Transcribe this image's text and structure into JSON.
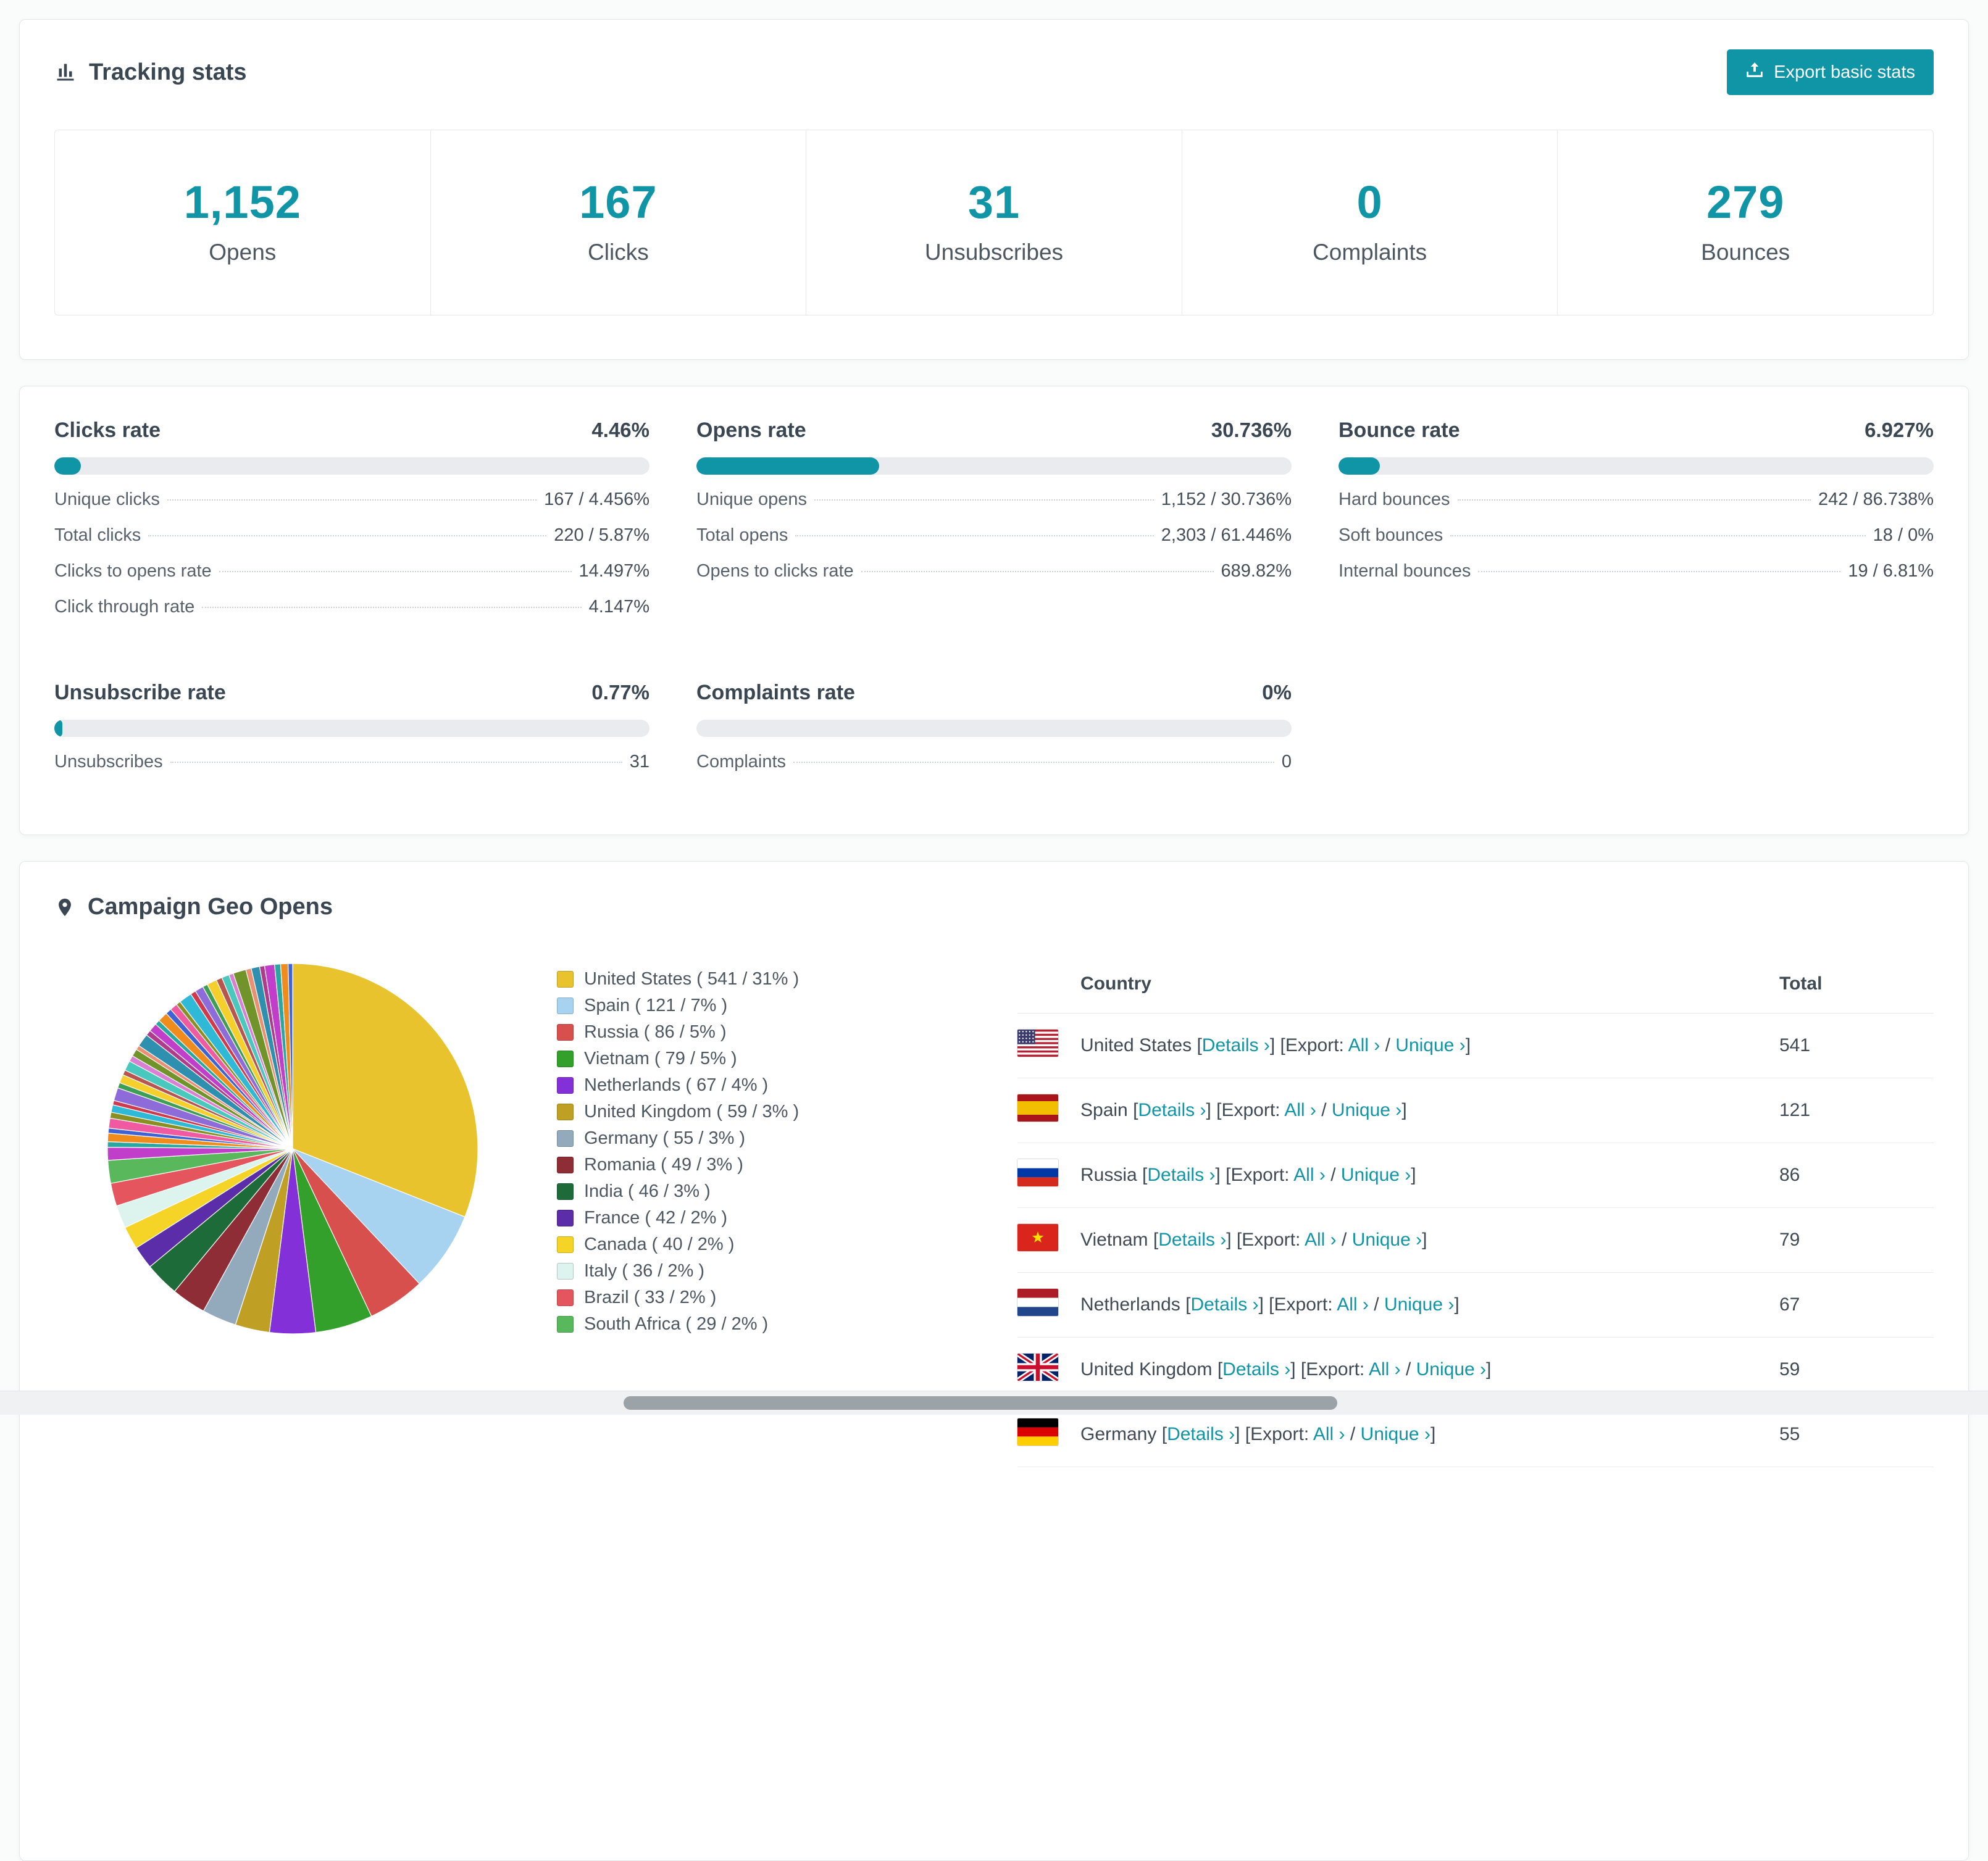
{
  "accent_color": "#1095a6",
  "tracking": {
    "title": "Tracking stats",
    "export_label": "Export basic stats",
    "stats": [
      {
        "value": "1,152",
        "label": "Opens"
      },
      {
        "value": "167",
        "label": "Clicks"
      },
      {
        "value": "31",
        "label": "Unsubscribes"
      },
      {
        "value": "0",
        "label": "Complaints"
      },
      {
        "value": "279",
        "label": "Bounces"
      }
    ]
  },
  "rates": [
    {
      "title": "Clicks rate",
      "percent_label": "4.46%",
      "percent": 4.46,
      "rows": [
        {
          "label": "Unique clicks",
          "value": "167 / 4.456%"
        },
        {
          "label": "Total clicks",
          "value": "220 / 5.87%"
        },
        {
          "label": "Clicks to opens rate",
          "value": "14.497%"
        },
        {
          "label": "Click through rate",
          "value": "4.147%"
        }
      ]
    },
    {
      "title": "Opens rate",
      "percent_label": "30.736%",
      "percent": 30.736,
      "rows": [
        {
          "label": "Unique opens",
          "value": "1,152 / 30.736%"
        },
        {
          "label": "Total opens",
          "value": "2,303 / 61.446%"
        },
        {
          "label": "Opens to clicks rate",
          "value": "689.82%"
        }
      ]
    },
    {
      "title": "Bounce rate",
      "percent_label": "6.927%",
      "percent": 6.927,
      "rows": [
        {
          "label": "Hard bounces",
          "value": "242 / 86.738%"
        },
        {
          "label": "Soft bounces",
          "value": "18 / 0%"
        },
        {
          "label": "Internal bounces",
          "value": "19 / 6.81%"
        }
      ]
    },
    {
      "title": "Unsubscribe rate",
      "percent_label": "0.77%",
      "percent": 0.77,
      "rows": [
        {
          "label": "Unsubscribes",
          "value": "31"
        }
      ]
    },
    {
      "title": "Complaints rate",
      "percent_label": "0%",
      "percent": 0,
      "rows": [
        {
          "label": "Complaints",
          "value": "0"
        }
      ]
    }
  ],
  "geo": {
    "title": "Campaign Geo Opens",
    "table": {
      "country_header": "Country",
      "total_header": "Total",
      "tokens": {
        "lb": "[",
        "rb": "]",
        "details": "Details ›",
        "export": "[Export:",
        "all": "All ›",
        "slash": "/",
        "unique": "Unique ›"
      },
      "rows": [
        {
          "country": "United States",
          "total": 541,
          "flag": "us"
        },
        {
          "country": "Spain",
          "total": 121,
          "flag": "es"
        },
        {
          "country": "Russia",
          "total": 86,
          "flag": "ru"
        },
        {
          "country": "Vietnam",
          "total": 79,
          "flag": "vn"
        },
        {
          "country": "Netherlands",
          "total": 67,
          "flag": "nl"
        },
        {
          "country": "United Kingdom",
          "total": 59,
          "flag": "gb"
        },
        {
          "country": "Germany",
          "total": 55,
          "flag": "de"
        }
      ]
    }
  },
  "chart_data": {
    "type": "pie",
    "title": "Campaign Geo Opens",
    "legend_position": "right",
    "items": [
      {
        "name": "United States",
        "value": 541,
        "percent": 31,
        "color": "#e8c32e"
      },
      {
        "name": "Spain",
        "value": 121,
        "percent": 7,
        "color": "#a8d3f0"
      },
      {
        "name": "Russia",
        "value": 86,
        "percent": 5,
        "color": "#d7504d"
      },
      {
        "name": "Vietnam",
        "value": 79,
        "percent": 5,
        "color": "#33a02c"
      },
      {
        "name": "Netherlands",
        "value": 67,
        "percent": 4,
        "color": "#8430d9"
      },
      {
        "name": "United Kingdom",
        "value": 59,
        "percent": 3,
        "color": "#bfa024"
      },
      {
        "name": "Germany",
        "value": 55,
        "percent": 3,
        "color": "#93a9bc"
      },
      {
        "name": "Romania",
        "value": 49,
        "percent": 3,
        "color": "#8f2d36"
      },
      {
        "name": "India",
        "value": 46,
        "percent": 3,
        "color": "#1e6b3a"
      },
      {
        "name": "France",
        "value": 42,
        "percent": 2,
        "color": "#5b2da8"
      },
      {
        "name": "Canada",
        "value": 40,
        "percent": 2,
        "color": "#f6d327"
      },
      {
        "name": "Italy",
        "value": 36,
        "percent": 2,
        "color": "#dcf3ee"
      },
      {
        "name": "Brazil",
        "value": 33,
        "percent": 2,
        "color": "#e4555e"
      },
      {
        "name": "South Africa",
        "value": 29,
        "percent": 2,
        "color": "#59b75c"
      }
    ],
    "others_percent": 26,
    "others_palette": [
      "#c13ecb",
      "#2aa7a0",
      "#f08c1b",
      "#3f63d2",
      "#ef5aa0",
      "#8a8f23",
      "#30b9d6",
      "#cf3a4e",
      "#8d6bd8",
      "#3e9e57",
      "#f5d02c",
      "#b8554f",
      "#49c9bd",
      "#d97fd4",
      "#70932a",
      "#e98f72",
      "#2f8fae",
      "#b03a8c"
    ]
  }
}
